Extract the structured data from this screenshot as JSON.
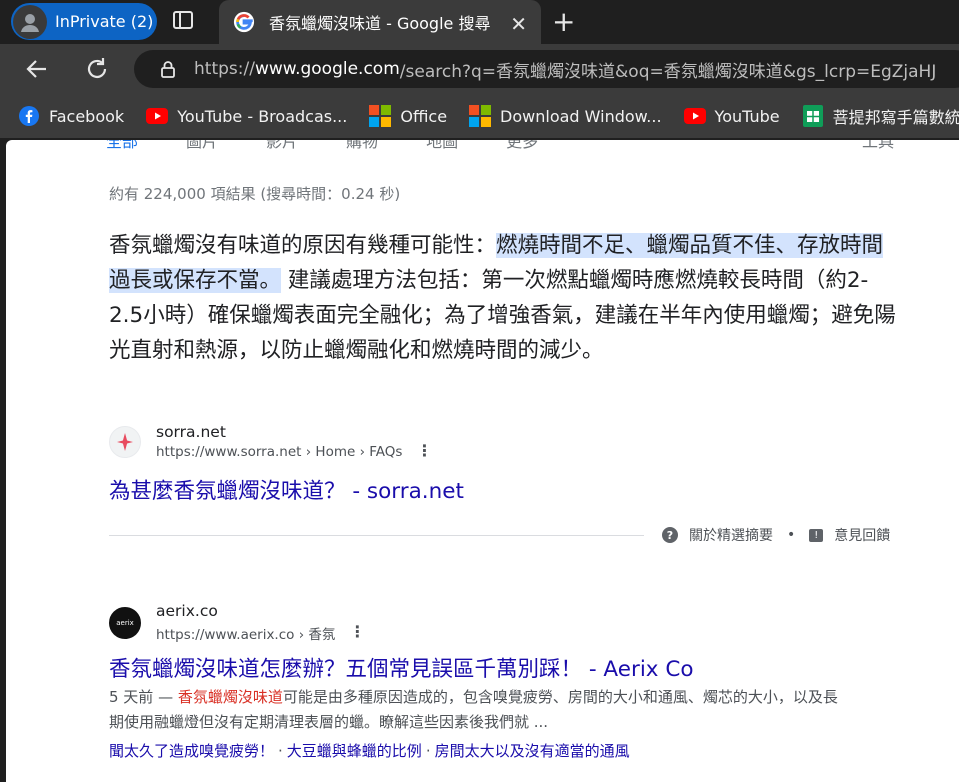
{
  "browser": {
    "inprivate_label": "InPrivate (2)",
    "tab_title": "香氛蠟燭沒味道 - Google 搜尋",
    "tab_close": "✕",
    "new_tab": "+",
    "url_host_prefix": "https://",
    "url_host": "www.google.com",
    "url_path": "/search?q=香氛蠟燭沒味道&oq=香氛蠟燭沒味道&gs_lcrp=EgZjaHJ"
  },
  "bookmarks": [
    {
      "label": "Facebook",
      "icon": "facebook-icon"
    },
    {
      "label": "YouTube - Broadcas...",
      "icon": "youtube-icon"
    },
    {
      "label": "Office",
      "icon": "microsoft-icon"
    },
    {
      "label": "Download Window...",
      "icon": "microsoft-icon"
    },
    {
      "label": "YouTube",
      "icon": "youtube-icon"
    },
    {
      "label": "菩提邦寫手篇數統...",
      "icon": "sheets-icon"
    }
  ],
  "search_tabs": [
    "全部",
    "圖片",
    "影片",
    "購物",
    "地圖",
    "更多"
  ],
  "tools_label": "工具",
  "stats": "約有 224,000 項結果 (搜尋時間：0.24 秒)",
  "featured": {
    "pre": "香氛蠟燭沒有味道的原因有幾種可能性：",
    "highlight": "燃燒時間不足、蠟燭品質不佳、存放時間過長或保存不當。",
    "post": " 建議處理方法包括：第一次燃點蠟燭時應燃燒較長時間（約2-2.5小時）確保蠟燭表面完全融化；為了增強香氣，建議在半年內使用蠟燭；避免陽光直射和熱源，以防止蠟燭融化和燃燒時間的減少。",
    "site_name": "sorra.net",
    "site_url": "https://www.sorra.net › Home › FAQs",
    "title": "為甚麼香氛蠟燭沒味道？ - sorra.net",
    "about_label": "關於精選摘要",
    "sep": "•",
    "feedback_label": "意見回饋"
  },
  "result2": {
    "site_name": "aerix.co",
    "site_url": "https://www.aerix.co › 香氛",
    "favicon_text": "aerix",
    "title": "香氛蠟燭沒味道怎麼辦？五個常見誤區千萬別踩！ - Aerix Co",
    "desc_date": "5 天前 — ",
    "desc_em": "香氛蠟燭沒味道",
    "desc_rest": "可能是由多種原因造成的，包含嗅覺疲勞、房間的大小和通風、燭芯的大小，以及長期使用融蠟燈但沒有定期清理表層的蠟。瞭解這些因素後我們就 ...",
    "sitelinks": [
      "聞太久了造成嗅覺疲勞！",
      "大豆蠟與蜂蠟的比例",
      "房間太大以及沒有適當的通風"
    ]
  }
}
